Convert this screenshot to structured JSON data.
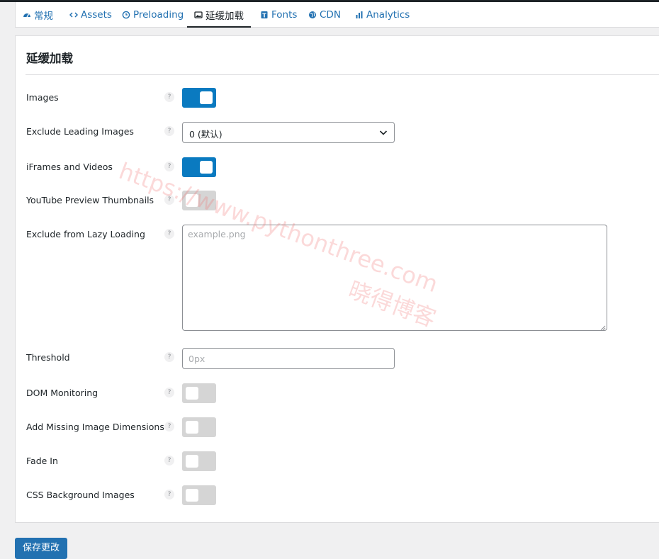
{
  "tabs": [
    {
      "label": "常规",
      "icon": "dashboard-icon"
    },
    {
      "label": "Assets",
      "icon": "code-icon"
    },
    {
      "label": "Preloading",
      "icon": "clock-icon"
    },
    {
      "label": "延缓加载",
      "icon": "image-icon",
      "active": true
    },
    {
      "label": "Fonts",
      "icon": "font-icon"
    },
    {
      "label": "CDN",
      "icon": "globe-icon"
    },
    {
      "label": "Analytics",
      "icon": "bar-chart-icon"
    }
  ],
  "panel": {
    "title": "延缓加载"
  },
  "help_symbol": "?",
  "fields": {
    "images": {
      "label": "Images",
      "enabled": true
    },
    "exclude_leading": {
      "label": "Exclude Leading Images",
      "value": "0 (默认)"
    },
    "iframes": {
      "label": "iFrames and Videos",
      "enabled": true
    },
    "youtube": {
      "label": "YouTube Preview Thumbnails",
      "enabled": false
    },
    "exclude_lazy": {
      "label": "Exclude from Lazy Loading",
      "placeholder": "example.png"
    },
    "threshold": {
      "label": "Threshold",
      "placeholder": "0px"
    },
    "dom_monitoring": {
      "label": "DOM Monitoring",
      "enabled": false
    },
    "missing_dims": {
      "label": "Add Missing Image Dimensions",
      "enabled": false
    },
    "fade_in": {
      "label": "Fade In",
      "enabled": false
    },
    "css_bg": {
      "label": "CSS Background Images",
      "enabled": false
    }
  },
  "save_button": "保存更改",
  "watermark": {
    "url": "https://www.pythonthree.com",
    "name": "晓得博客"
  },
  "colors": {
    "accent": "#2271b1",
    "toggle_on": "#0a7ac0",
    "toggle_off": "#d5d5d5"
  }
}
